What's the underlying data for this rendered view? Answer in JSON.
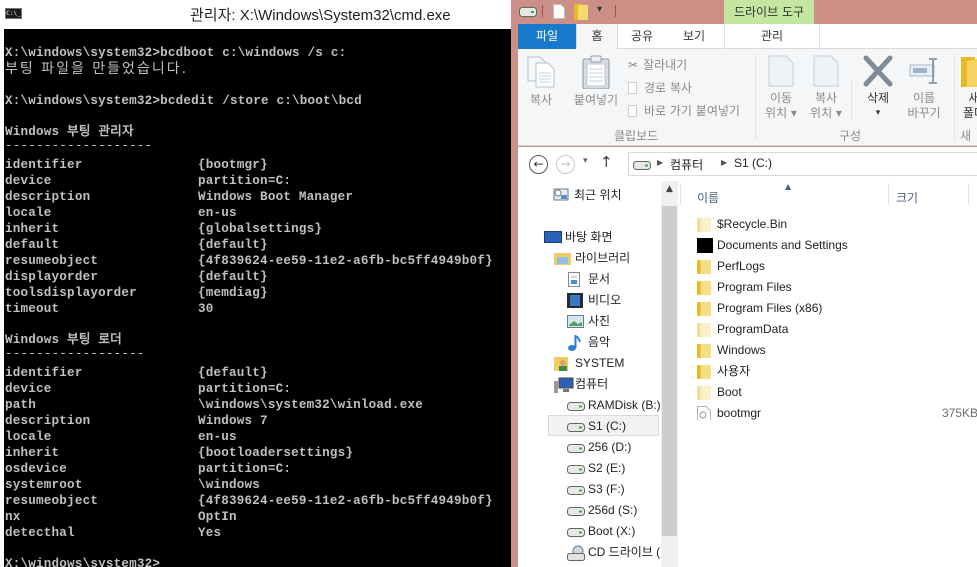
{
  "cmd": {
    "title": "관리자: X:\\Windows\\System32\\cmd.exe",
    "icon": "cmd-icon",
    "lines": [
      {
        "text": "X:\\windows\\system32>bcdboot c:\\windows /s c:"
      },
      {
        "text": "부팅 파일을 만들었습니다."
      },
      {
        "text": ""
      },
      {
        "text": "X:\\windows\\system32>bcdedit /store c:\\boot\\bcd"
      },
      {
        "text": ""
      },
      {
        "text": "Windows 부팅 관리자"
      },
      {
        "text": "-------------------"
      }
    ],
    "boot_manager": {
      "heading": "Windows 부팅 관리자",
      "underline": "-------------------",
      "entries": [
        {
          "key": "identifier",
          "value": "{bootmgr}"
        },
        {
          "key": "device",
          "value": "partition=C:"
        },
        {
          "key": "description",
          "value": "Windows Boot Manager"
        },
        {
          "key": "locale",
          "value": "en-us"
        },
        {
          "key": "inherit",
          "value": "{globalsettings}"
        },
        {
          "key": "default",
          "value": "{default}"
        },
        {
          "key": "resumeobject",
          "value": "{4f839624-ee59-11e2-a6fb-bc5ff4949b0f}"
        },
        {
          "key": "displayorder",
          "value": "{default}"
        },
        {
          "key": "toolsdisplayorder",
          "value": "{memdiag}"
        },
        {
          "key": "timeout",
          "value": "30"
        }
      ]
    },
    "boot_loader": {
      "heading": "Windows 부팅 로더",
      "underline": "------------------",
      "entries": [
        {
          "key": "identifier",
          "value": "{default}"
        },
        {
          "key": "device",
          "value": "partition=C:"
        },
        {
          "key": "path",
          "value": "\\windows\\system32\\winload.exe"
        },
        {
          "key": "description",
          "value": "Windows 7"
        },
        {
          "key": "locale",
          "value": "en-us"
        },
        {
          "key": "inherit",
          "value": "{bootloadersettings}"
        },
        {
          "key": "osdevice",
          "value": "partition=C:"
        },
        {
          "key": "systemroot",
          "value": "\\windows"
        },
        {
          "key": "resumeobject",
          "value": "{4f839624-ee59-11e2-a6fb-bc5ff4949b0f}"
        },
        {
          "key": "nx",
          "value": "OptIn"
        },
        {
          "key": "detecthal",
          "value": "Yes"
        }
      ]
    },
    "prompt": "X:\\windows\\system32>"
  },
  "explorer": {
    "contextual_tab_group": "드라이브 도구",
    "ribbon_tabs": {
      "file": "파일",
      "home": "홈",
      "share": "공유",
      "view": "보기",
      "manage": "관리"
    },
    "ribbon": {
      "copy": "복사",
      "paste": "붙여넣기",
      "cut": "잘라내기",
      "copy_path": "경로 복사",
      "paste_shortcut": "바로 가기 붙여넣기",
      "clipboard_group": "클립보드",
      "move_to_1": "이동",
      "move_to_2": "위치 ▾",
      "copy_to_1": "복사",
      "copy_to_2": "위치 ▾",
      "delete": "삭제",
      "delete_arrow": "▾",
      "rename_1": "이름",
      "rename_2": "바꾸기",
      "organize_group": "구성",
      "new_folder_1": "새",
      "new_folder_2": "폴더",
      "new_group": "새로"
    },
    "address": {
      "back": "←",
      "forward": "→",
      "recent": "▾",
      "up": "↑",
      "crumbs": [
        "컴퓨터",
        "S1 (C:)"
      ]
    },
    "nav_pane": {
      "items": [
        {
          "label": "최근 위치",
          "icon": "recent-places-icon"
        },
        {
          "label": "바탕 화면",
          "icon": "desktop-icon"
        },
        {
          "label": "라이브러리",
          "icon": "libraries-icon"
        },
        {
          "label": "문서",
          "icon": "documents-icon"
        },
        {
          "label": "비디오",
          "icon": "videos-icon"
        },
        {
          "label": "사진",
          "icon": "pictures-icon"
        },
        {
          "label": "음악",
          "icon": "music-icon"
        },
        {
          "label": "SYSTEM",
          "icon": "user-folder-icon"
        },
        {
          "label": "컴퓨터",
          "icon": "computer-icon"
        },
        {
          "label": "RAMDisk (B:)",
          "icon": "drive-icon"
        },
        {
          "label": "S1 (C:)",
          "icon": "drive-icon",
          "selected": true
        },
        {
          "label": "256 (D:)",
          "icon": "drive-icon"
        },
        {
          "label": "S2 (E:)",
          "icon": "drive-icon"
        },
        {
          "label": "S3 (F:)",
          "icon": "drive-icon"
        },
        {
          "label": "256d (S:)",
          "icon": "drive-icon"
        },
        {
          "label": "Boot (X:)",
          "icon": "drive-icon"
        },
        {
          "label": "CD 드라이브 (",
          "icon": "cd-drive-icon"
        }
      ]
    },
    "columns": {
      "name": "이름",
      "size": "크기",
      "sort_indicator": "▲"
    },
    "files": [
      {
        "name": "$Recycle.Bin",
        "size": "",
        "icon": "folder-hidden-icon"
      },
      {
        "name": "Documents and Settings",
        "size": "",
        "icon": "junction-icon"
      },
      {
        "name": "PerfLogs",
        "size": "",
        "icon": "folder-icon"
      },
      {
        "name": "Program Files",
        "size": "",
        "icon": "folder-icon"
      },
      {
        "name": "Program Files (x86)",
        "size": "",
        "icon": "folder-icon"
      },
      {
        "name": "ProgramData",
        "size": "",
        "icon": "folder-hidden-icon"
      },
      {
        "name": "Windows",
        "size": "",
        "icon": "folder-icon"
      },
      {
        "name": "사용자",
        "size": "",
        "icon": "folder-icon"
      },
      {
        "name": "Boot",
        "size": "",
        "icon": "folder-hidden-icon"
      },
      {
        "name": "bootmgr",
        "size": "375KB",
        "icon": "system-file-icon"
      }
    ],
    "colors": {
      "window_frame": "#cb8f86",
      "file_tab": "#1979ca",
      "contextual_tab": "#c3e6a0"
    }
  }
}
